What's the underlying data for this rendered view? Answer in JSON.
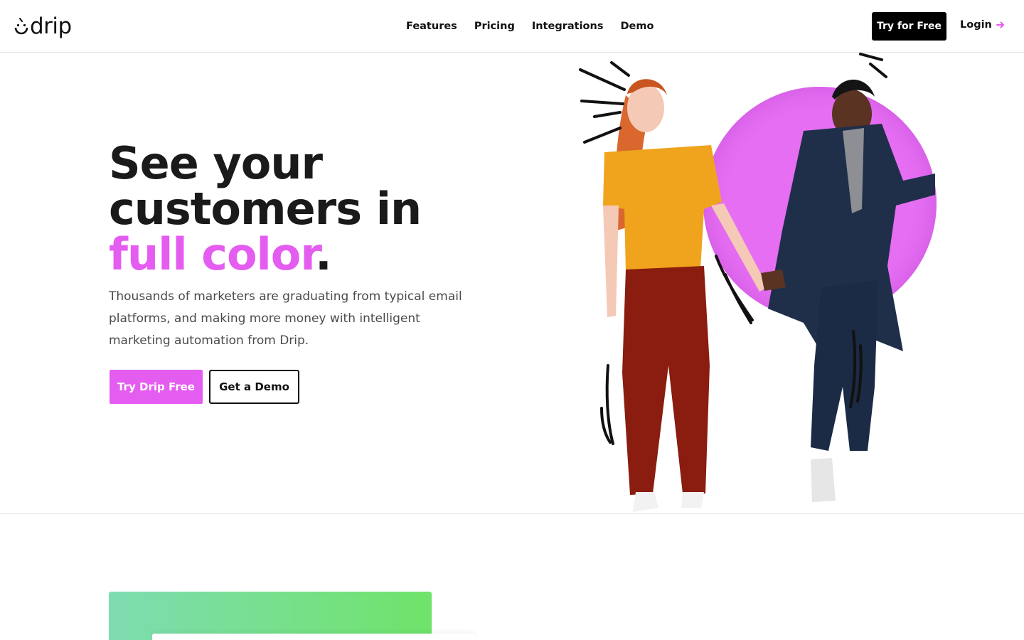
{
  "header": {
    "logo_text": "drip",
    "nav": [
      {
        "label": "Features"
      },
      {
        "label": "Pricing"
      },
      {
        "label": "Integrations"
      },
      {
        "label": "Demo"
      }
    ],
    "cta_label": "Try for Free",
    "login_label": "Login"
  },
  "hero": {
    "title_line1": "See your",
    "title_line2": "customers in",
    "title_accent": "full color",
    "title_period": ".",
    "subtitle": "Thousands of marketers are graduating from typical email platforms, and making more money with intelligent marketing automation from Drip.",
    "primary_button": "Try Drip Free",
    "secondary_button": "Get a Demo"
  },
  "icons": {
    "logo": "drip-smile-logo-icon",
    "login_arrow": "arrow-right-icon"
  },
  "colors": {
    "accent": "#e55cf0",
    "dark": "#000000",
    "gradient_start": "#7fdcb2",
    "gradient_end": "#6fe36a"
  }
}
